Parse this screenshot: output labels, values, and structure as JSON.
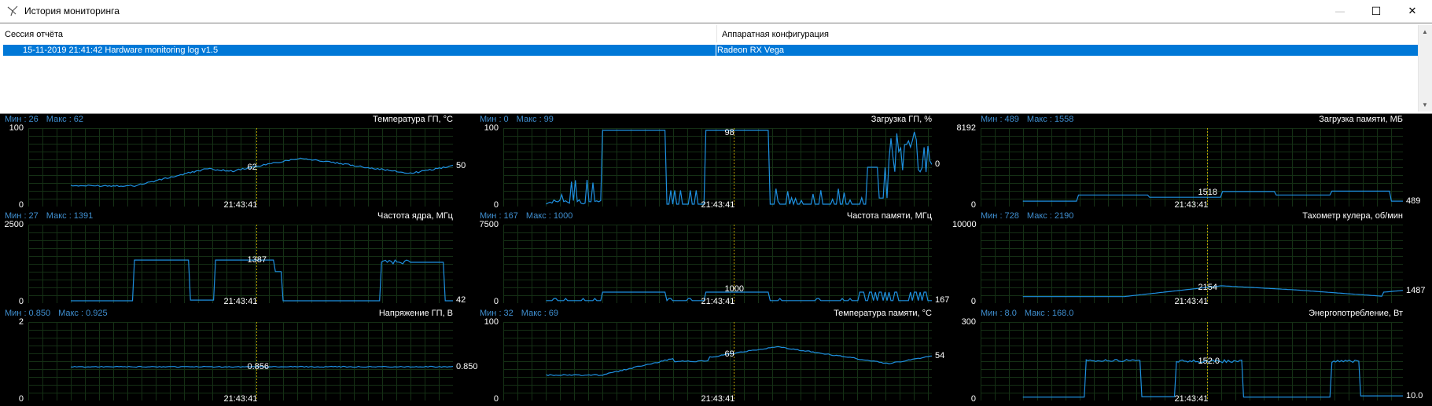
{
  "window": {
    "title": "История мониторинга",
    "controls": {
      "minimize": "—",
      "maximize": "☐",
      "close": "✕"
    }
  },
  "session_list": {
    "columns": [
      "Сессия отчёта",
      "Аппаратная конфигурация"
    ],
    "rows": [
      {
        "session": "15-11-2019 21:41:42 Hardware monitoring log v1.5",
        "config": "Radeon RX Vega"
      }
    ]
  },
  "colors": {
    "accent": "#0078d7",
    "graph_line": "#1e90e0",
    "graph_bg": "#000000",
    "grid": "#153015",
    "cursor": "#b8a000"
  },
  "graphs": [
    {
      "title": "Температура ГП, °C",
      "min": "Мин : 26",
      "max": "Макс : 62",
      "ymax": "100",
      "ymin": "0",
      "time": "21:43:41",
      "cursor_value": "62",
      "end_value": "50"
    },
    {
      "title": "Загрузка ГП, %",
      "min": "Мин : 0",
      "max": "Макс : 99",
      "ymax": "100",
      "ymin": "0",
      "time": "21:43:41",
      "cursor_value": "98",
      "end_value": "0"
    },
    {
      "title": "Загрузка памяти, МБ",
      "min": "Мин : 489",
      "max": "Макс : 1558",
      "ymax": "8192",
      "ymin": "0",
      "time": "21:43:41",
      "cursor_value": "1518",
      "end_value": "489"
    },
    {
      "title": "Частота ядра, МГц",
      "min": "Мин : 27",
      "max": "Макс : 1391",
      "ymax": "2500",
      "ymin": "0",
      "time": "21:43:41",
      "cursor_value": "1387",
      "end_value": "42"
    },
    {
      "title": "Частота памяти, МГц",
      "min": "Мин : 167",
      "max": "Макс : 1000",
      "ymax": "7500",
      "ymin": "0",
      "time": "21:43:41",
      "cursor_value": "1000",
      "end_value": "167"
    },
    {
      "title": "Тахометр кулера, об/мин",
      "min": "Мин : 728",
      "max": "Макс : 2190",
      "ymax": "10000",
      "ymin": "0",
      "time": "21:43:41",
      "cursor_value": "2154",
      "end_value": "1487"
    },
    {
      "title": "Напряжение ГП, В",
      "min": "Мин : 0.850",
      "max": "Макс : 0.925",
      "ymax": "2",
      "ymin": "0",
      "time": "21:43:41",
      "cursor_value": "0.856",
      "end_value": "0.850"
    },
    {
      "title": "Температура памяти, °C",
      "min": "Мин : 32",
      "max": "Макс : 69",
      "ymax": "100",
      "ymin": "0",
      "time": "21:43:41",
      "cursor_value": "69",
      "end_value": "54"
    },
    {
      "title": "Энергопотребление, Вт",
      "min": "Мин : 8.0",
      "max": "Макс : 168.0",
      "ymax": "300",
      "ymin": "0",
      "time": "21:43:41",
      "cursor_value": "152.0",
      "end_value": "10.0"
    }
  ]
}
